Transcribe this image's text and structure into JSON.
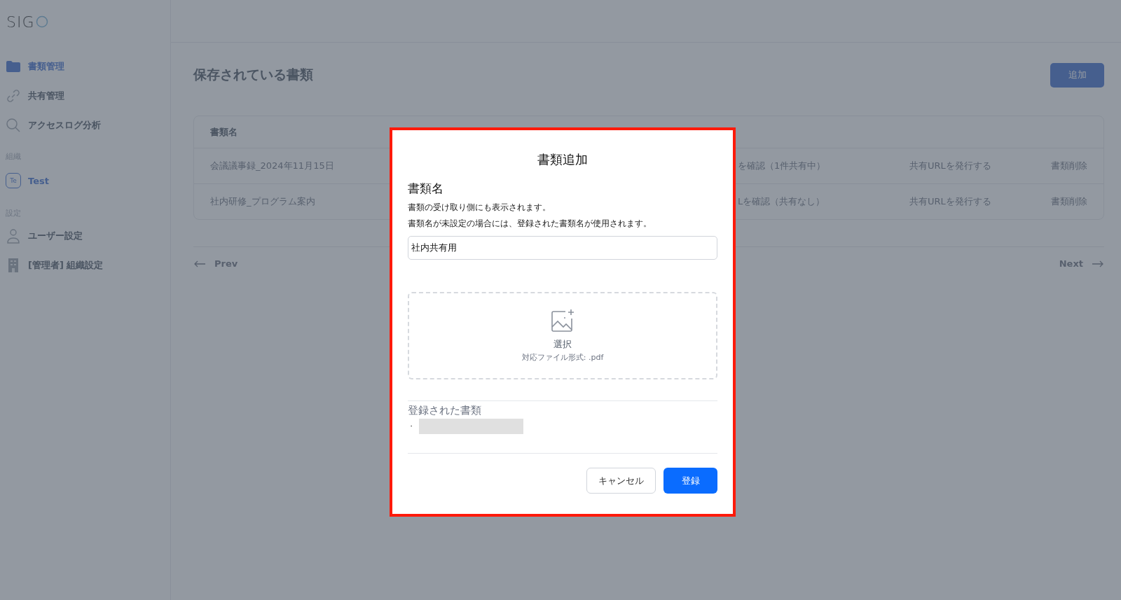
{
  "logo": {
    "text": "SIG"
  },
  "sidebar": {
    "items": [
      {
        "kind": "folder",
        "label": "書類管理",
        "selected": true
      },
      {
        "kind": "link",
        "label": "共有管理",
        "selected": false
      },
      {
        "kind": "search",
        "label": "アクセスログ分析",
        "selected": false
      }
    ],
    "organization": {
      "heading": "組織",
      "badge": "Te",
      "name": "Test",
      "selected": true
    },
    "settings": {
      "heading": "設定",
      "items": [
        {
          "kind": "user",
          "label": "ユーザー設定",
          "selected": false
        },
        {
          "kind": "building",
          "label": "[管理者] 組織設定",
          "selected": false
        }
      ]
    }
  },
  "page": {
    "title": "保存されている書類",
    "add_button": "追加"
  },
  "table": {
    "columns": [
      "書類名"
    ],
    "rows": [
      {
        "name": "会議議事録_2024年11月15日",
        "column_2": "を確認（1件共有中）",
        "share": "共有URLを発行する",
        "delete": "書類削除"
      },
      {
        "name": "社内研修_プログラム案内",
        "column_2": "Lを確認（共有なし）",
        "share": "共有URLを発行する",
        "delete": "書類削除"
      }
    ]
  },
  "pagination": {
    "prev": "Prev",
    "next": "Next"
  },
  "dialog": {
    "title": "書類追加",
    "field_label": "書類名",
    "help": [
      "書類の受け取り側にも表示されます。",
      "書類名が未設定の場合には、登録された書類名が使用されます。"
    ],
    "name_value": "社内共有用",
    "dropzone": {
      "label": "選択",
      "formats": "対応ファイル形式: .pdf"
    },
    "registered": {
      "heading": "登録された書類",
      "bullet": "・"
    },
    "cancel": "キャンセル",
    "submit": "登録"
  }
}
